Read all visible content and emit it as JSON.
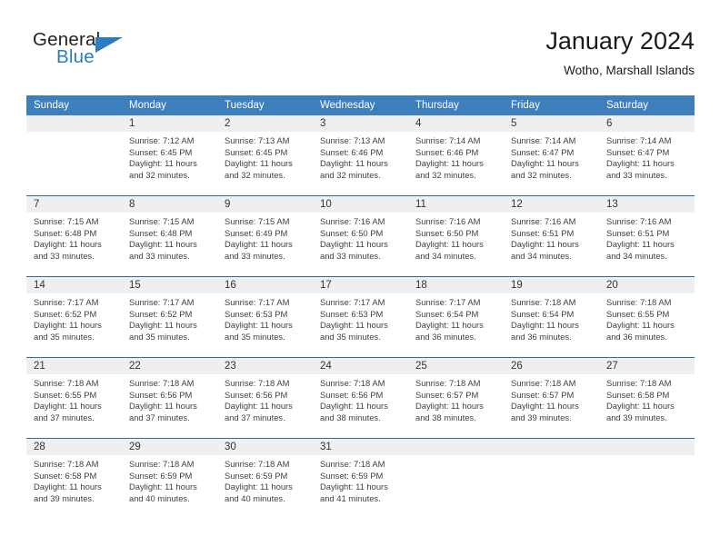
{
  "brand": {
    "name_part1": "General",
    "name_part2": "Blue",
    "triangle_icon": "triangle-icon",
    "accent_color": "#2b7cc0"
  },
  "header": {
    "title": "January 2024",
    "subtitle": "Wotho, Marshall Islands"
  },
  "calendar": {
    "header_color": "#3d7ebd",
    "row_divider_color": "#2b6ca8",
    "daynum_band_color": "#efefef",
    "weekdays": [
      "Sunday",
      "Monday",
      "Tuesday",
      "Wednesday",
      "Thursday",
      "Friday",
      "Saturday"
    ],
    "weeks": [
      [
        {
          "day": "",
          "sunrise": "",
          "sunset": "",
          "daylight_line1": "",
          "daylight_line2": ""
        },
        {
          "day": "1",
          "sunrise": "Sunrise: 7:12 AM",
          "sunset": "Sunset: 6:45 PM",
          "daylight_line1": "Daylight: 11 hours",
          "daylight_line2": "and 32 minutes."
        },
        {
          "day": "2",
          "sunrise": "Sunrise: 7:13 AM",
          "sunset": "Sunset: 6:45 PM",
          "daylight_line1": "Daylight: 11 hours",
          "daylight_line2": "and 32 minutes."
        },
        {
          "day": "3",
          "sunrise": "Sunrise: 7:13 AM",
          "sunset": "Sunset: 6:46 PM",
          "daylight_line1": "Daylight: 11 hours",
          "daylight_line2": "and 32 minutes."
        },
        {
          "day": "4",
          "sunrise": "Sunrise: 7:14 AM",
          "sunset": "Sunset: 6:46 PM",
          "daylight_line1": "Daylight: 11 hours",
          "daylight_line2": "and 32 minutes."
        },
        {
          "day": "5",
          "sunrise": "Sunrise: 7:14 AM",
          "sunset": "Sunset: 6:47 PM",
          "daylight_line1": "Daylight: 11 hours",
          "daylight_line2": "and 32 minutes."
        },
        {
          "day": "6",
          "sunrise": "Sunrise: 7:14 AM",
          "sunset": "Sunset: 6:47 PM",
          "daylight_line1": "Daylight: 11 hours",
          "daylight_line2": "and 33 minutes."
        }
      ],
      [
        {
          "day": "7",
          "sunrise": "Sunrise: 7:15 AM",
          "sunset": "Sunset: 6:48 PM",
          "daylight_line1": "Daylight: 11 hours",
          "daylight_line2": "and 33 minutes."
        },
        {
          "day": "8",
          "sunrise": "Sunrise: 7:15 AM",
          "sunset": "Sunset: 6:48 PM",
          "daylight_line1": "Daylight: 11 hours",
          "daylight_line2": "and 33 minutes."
        },
        {
          "day": "9",
          "sunrise": "Sunrise: 7:15 AM",
          "sunset": "Sunset: 6:49 PM",
          "daylight_line1": "Daylight: 11 hours",
          "daylight_line2": "and 33 minutes."
        },
        {
          "day": "10",
          "sunrise": "Sunrise: 7:16 AM",
          "sunset": "Sunset: 6:50 PM",
          "daylight_line1": "Daylight: 11 hours",
          "daylight_line2": "and 33 minutes."
        },
        {
          "day": "11",
          "sunrise": "Sunrise: 7:16 AM",
          "sunset": "Sunset: 6:50 PM",
          "daylight_line1": "Daylight: 11 hours",
          "daylight_line2": "and 34 minutes."
        },
        {
          "day": "12",
          "sunrise": "Sunrise: 7:16 AM",
          "sunset": "Sunset: 6:51 PM",
          "daylight_line1": "Daylight: 11 hours",
          "daylight_line2": "and 34 minutes."
        },
        {
          "day": "13",
          "sunrise": "Sunrise: 7:16 AM",
          "sunset": "Sunset: 6:51 PM",
          "daylight_line1": "Daylight: 11 hours",
          "daylight_line2": "and 34 minutes."
        }
      ],
      [
        {
          "day": "14",
          "sunrise": "Sunrise: 7:17 AM",
          "sunset": "Sunset: 6:52 PM",
          "daylight_line1": "Daylight: 11 hours",
          "daylight_line2": "and 35 minutes."
        },
        {
          "day": "15",
          "sunrise": "Sunrise: 7:17 AM",
          "sunset": "Sunset: 6:52 PM",
          "daylight_line1": "Daylight: 11 hours",
          "daylight_line2": "and 35 minutes."
        },
        {
          "day": "16",
          "sunrise": "Sunrise: 7:17 AM",
          "sunset": "Sunset: 6:53 PM",
          "daylight_line1": "Daylight: 11 hours",
          "daylight_line2": "and 35 minutes."
        },
        {
          "day": "17",
          "sunrise": "Sunrise: 7:17 AM",
          "sunset": "Sunset: 6:53 PM",
          "daylight_line1": "Daylight: 11 hours",
          "daylight_line2": "and 35 minutes."
        },
        {
          "day": "18",
          "sunrise": "Sunrise: 7:17 AM",
          "sunset": "Sunset: 6:54 PM",
          "daylight_line1": "Daylight: 11 hours",
          "daylight_line2": "and 36 minutes."
        },
        {
          "day": "19",
          "sunrise": "Sunrise: 7:18 AM",
          "sunset": "Sunset: 6:54 PM",
          "daylight_line1": "Daylight: 11 hours",
          "daylight_line2": "and 36 minutes."
        },
        {
          "day": "20",
          "sunrise": "Sunrise: 7:18 AM",
          "sunset": "Sunset: 6:55 PM",
          "daylight_line1": "Daylight: 11 hours",
          "daylight_line2": "and 36 minutes."
        }
      ],
      [
        {
          "day": "21",
          "sunrise": "Sunrise: 7:18 AM",
          "sunset": "Sunset: 6:55 PM",
          "daylight_line1": "Daylight: 11 hours",
          "daylight_line2": "and 37 minutes."
        },
        {
          "day": "22",
          "sunrise": "Sunrise: 7:18 AM",
          "sunset": "Sunset: 6:56 PM",
          "daylight_line1": "Daylight: 11 hours",
          "daylight_line2": "and 37 minutes."
        },
        {
          "day": "23",
          "sunrise": "Sunrise: 7:18 AM",
          "sunset": "Sunset: 6:56 PM",
          "daylight_line1": "Daylight: 11 hours",
          "daylight_line2": "and 37 minutes."
        },
        {
          "day": "24",
          "sunrise": "Sunrise: 7:18 AM",
          "sunset": "Sunset: 6:56 PM",
          "daylight_line1": "Daylight: 11 hours",
          "daylight_line2": "and 38 minutes."
        },
        {
          "day": "25",
          "sunrise": "Sunrise: 7:18 AM",
          "sunset": "Sunset: 6:57 PM",
          "daylight_line1": "Daylight: 11 hours",
          "daylight_line2": "and 38 minutes."
        },
        {
          "day": "26",
          "sunrise": "Sunrise: 7:18 AM",
          "sunset": "Sunset: 6:57 PM",
          "daylight_line1": "Daylight: 11 hours",
          "daylight_line2": "and 39 minutes."
        },
        {
          "day": "27",
          "sunrise": "Sunrise: 7:18 AM",
          "sunset": "Sunset: 6:58 PM",
          "daylight_line1": "Daylight: 11 hours",
          "daylight_line2": "and 39 minutes."
        }
      ],
      [
        {
          "day": "28",
          "sunrise": "Sunrise: 7:18 AM",
          "sunset": "Sunset: 6:58 PM",
          "daylight_line1": "Daylight: 11 hours",
          "daylight_line2": "and 39 minutes."
        },
        {
          "day": "29",
          "sunrise": "Sunrise: 7:18 AM",
          "sunset": "Sunset: 6:59 PM",
          "daylight_line1": "Daylight: 11 hours",
          "daylight_line2": "and 40 minutes."
        },
        {
          "day": "30",
          "sunrise": "Sunrise: 7:18 AM",
          "sunset": "Sunset: 6:59 PM",
          "daylight_line1": "Daylight: 11 hours",
          "daylight_line2": "and 40 minutes."
        },
        {
          "day": "31",
          "sunrise": "Sunrise: 7:18 AM",
          "sunset": "Sunset: 6:59 PM",
          "daylight_line1": "Daylight: 11 hours",
          "daylight_line2": "and 41 minutes."
        },
        {
          "day": "",
          "sunrise": "",
          "sunset": "",
          "daylight_line1": "",
          "daylight_line2": ""
        },
        {
          "day": "",
          "sunrise": "",
          "sunset": "",
          "daylight_line1": "",
          "daylight_line2": ""
        },
        {
          "day": "",
          "sunrise": "",
          "sunset": "",
          "daylight_line1": "",
          "daylight_line2": ""
        }
      ]
    ]
  }
}
